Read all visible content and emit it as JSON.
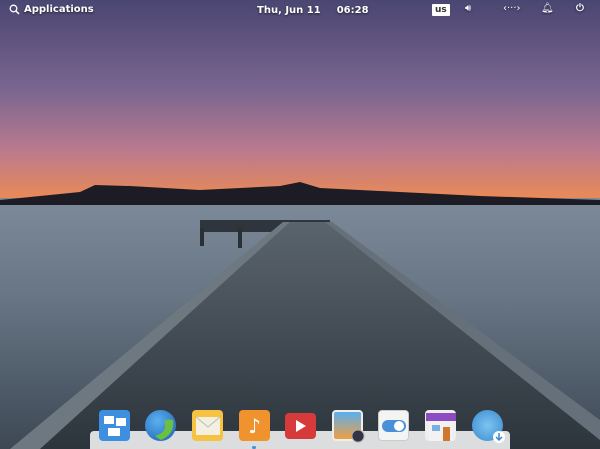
{
  "panel": {
    "applications_label": "Applications",
    "date": "Thu, Jun 11",
    "time": "06:28",
    "keyboard_layout": "us"
  },
  "dock": {
    "items": [
      "Multitasking View",
      "Web Browser",
      "Mail",
      "Music",
      "Videos",
      "Photos",
      "System Settings",
      "AppCenter",
      "Software Updates"
    ]
  },
  "colors": {
    "accent": "#4a90d9",
    "panel_text": "#ffffff"
  }
}
